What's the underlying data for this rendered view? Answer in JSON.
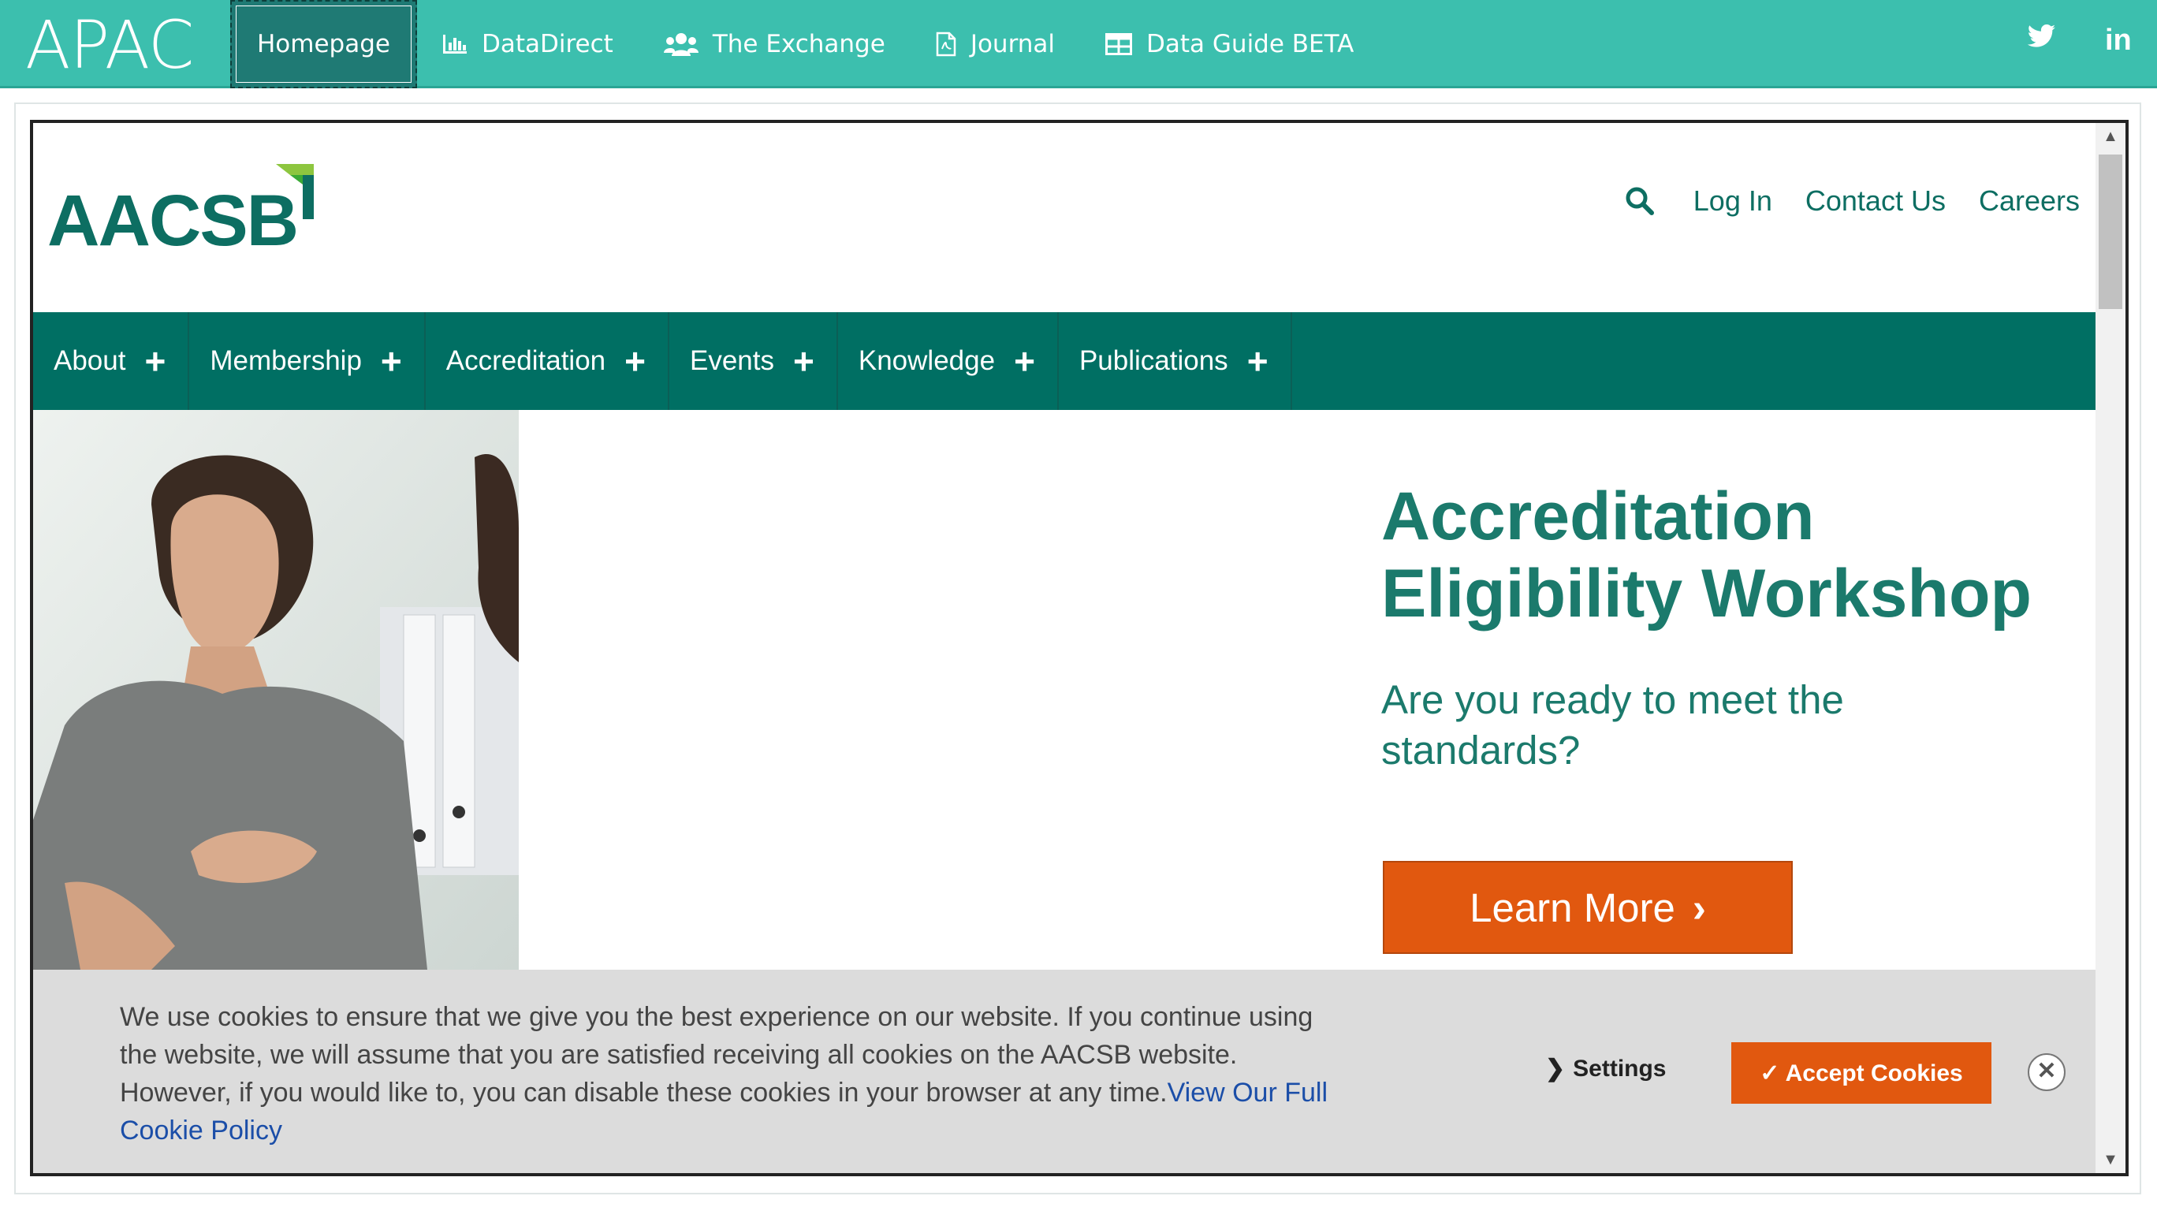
{
  "topbar": {
    "brand": "APAC",
    "nav": [
      {
        "label": "Homepage",
        "icon": "",
        "active": true
      },
      {
        "label": "DataDirect",
        "icon": "bar-chart-icon"
      },
      {
        "label": "The Exchange",
        "icon": "users-icon"
      },
      {
        "label": "Journal",
        "icon": "pdf-file-icon"
      },
      {
        "label": "Data Guide BETA",
        "icon": "table-icon"
      }
    ],
    "social": [
      "twitter-icon",
      "linkedin-icon"
    ],
    "linkedin_label": "in"
  },
  "site": {
    "logo_text": "AACSB",
    "utility": {
      "login": "Log In",
      "contact": "Contact Us",
      "careers": "Careers"
    },
    "nav": [
      {
        "label": "About"
      },
      {
        "label": "Membership"
      },
      {
        "label": "Accreditation"
      },
      {
        "label": "Events"
      },
      {
        "label": "Knowledge"
      },
      {
        "label": "Publications"
      }
    ],
    "nav_expand": "+"
  },
  "hero": {
    "title_line1": "Accreditation",
    "title_line2": "Eligibility Workshop",
    "subtitle": "Are you ready to meet the standards?",
    "button": "Learn More",
    "button_chevron": "›"
  },
  "cookie": {
    "text": "We use cookies to ensure that we give you the best experience on our website. If you continue using the website, we will assume that you are satisfied receiving all cookies on the AACSB website. However, if you would like to, you can disable these cookies in your browser at any time.",
    "link": "View Our Full Cookie Policy",
    "settings": "Settings",
    "settings_chevron": "❯",
    "accept": "✓ Accept Cookies",
    "close": "✕"
  },
  "colors": {
    "topbar": "#3cbfae",
    "brand_green": "#006f63",
    "text_green": "#1b7a6c",
    "orange": "#e1580f"
  }
}
